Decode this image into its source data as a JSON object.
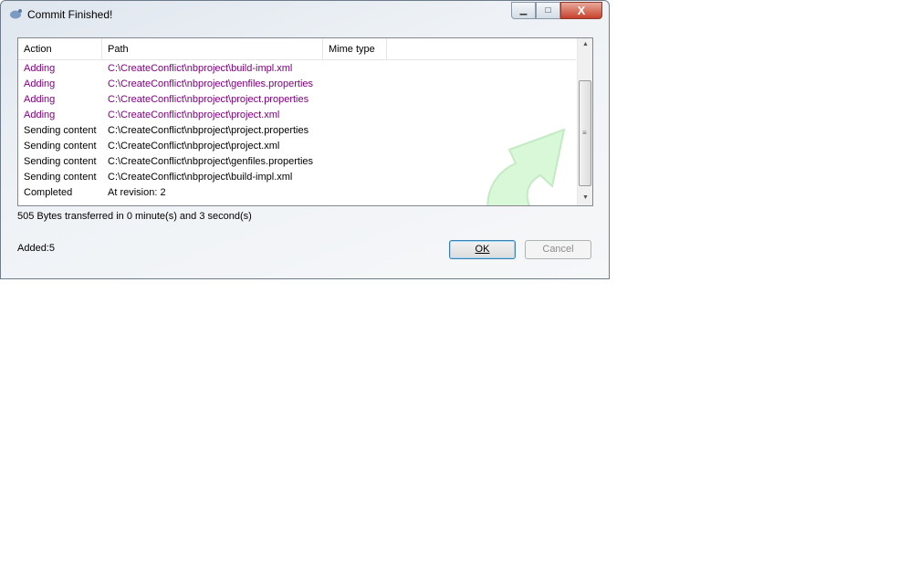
{
  "window": {
    "title": "Commit Finished!",
    "minimize": "–",
    "maximize": "□",
    "close": "X"
  },
  "list": {
    "columns": [
      "Action",
      "Path",
      "Mime type"
    ],
    "rows": [
      {
        "action": "Adding",
        "path": "C:\\CreateConflict\\nbproject\\build-impl.xml",
        "kind": "added"
      },
      {
        "action": "Adding",
        "path": "C:\\CreateConflict\\nbproject\\genfiles.properties",
        "kind": "added"
      },
      {
        "action": "Adding",
        "path": "C:\\CreateConflict\\nbproject\\project.properties",
        "kind": "added"
      },
      {
        "action": "Adding",
        "path": "C:\\CreateConflict\\nbproject\\project.xml",
        "kind": "added"
      },
      {
        "action": "Sending content",
        "path": "C:\\CreateConflict\\nbproject\\project.properties",
        "kind": "normal"
      },
      {
        "action": "Sending content",
        "path": "C:\\CreateConflict\\nbproject\\project.xml",
        "kind": "normal"
      },
      {
        "action": "Sending content",
        "path": "C:\\CreateConflict\\nbproject\\genfiles.properties",
        "kind": "normal"
      },
      {
        "action": "Sending content",
        "path": "C:\\CreateConflict\\nbproject\\build-impl.xml",
        "kind": "normal"
      },
      {
        "action": "Completed",
        "path": "At revision: 2",
        "kind": "normal"
      }
    ]
  },
  "status": "505 Bytes transferred in 0 minute(s) and 3 second(s)",
  "summary": "Added:5",
  "buttons": {
    "ok": "OK",
    "cancel": "Cancel"
  },
  "colors": {
    "added": "#800080",
    "arrow": "#c8f5c8"
  }
}
